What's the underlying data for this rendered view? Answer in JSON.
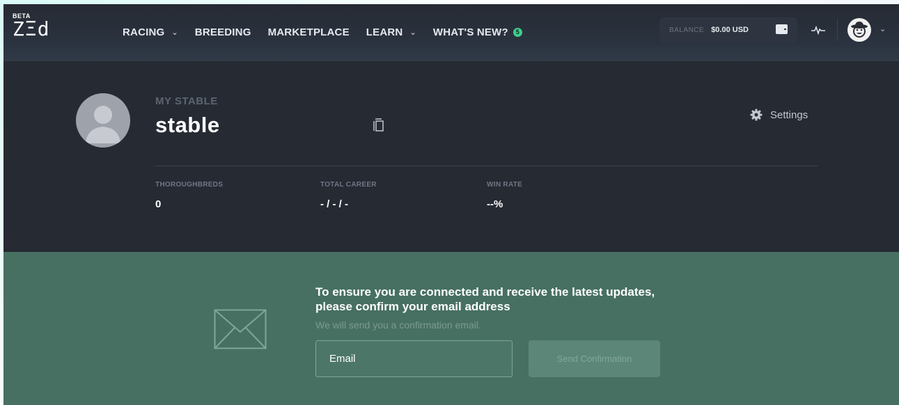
{
  "header": {
    "logo_beta": "BETA",
    "logo_name": "ZΞd",
    "nav": [
      {
        "label": "RACING",
        "has_chevron": true
      },
      {
        "label": "BREEDING",
        "has_chevron": false
      },
      {
        "label": "MARKETPLACE",
        "has_chevron": false
      },
      {
        "label": "LEARN",
        "has_chevron": true
      },
      {
        "label": "WHAT'S NEW?",
        "badge": "5"
      }
    ],
    "balance_label": "BALANCE",
    "balance_value": "$0.00 USD",
    "icons": [
      "wallet-icon",
      "pulse-icon",
      "cowboy-avatar-icon",
      "chevron-down-icon"
    ]
  },
  "profile": {
    "section_label": "MY STABLE",
    "stable_name": "stable",
    "settings_label": "Settings",
    "stats": [
      {
        "label": "THOROUGHBREDS",
        "value": "0"
      },
      {
        "label": "TOTAL CAREER",
        "value": "- / - / -"
      },
      {
        "label": "WIN RATE",
        "value": "--%"
      }
    ]
  },
  "confirm": {
    "title": "To ensure you are connected and receive the latest updates, please confirm your email address",
    "subtitle": "We will send you a confirmation email.",
    "email_placeholder": "Email",
    "button_label": "Send Confirmation"
  },
  "colors": {
    "header_bg": "#262a33",
    "page_bg": "#262a33",
    "confirm_bg": "#477062",
    "badge": "#3ecf8e"
  }
}
